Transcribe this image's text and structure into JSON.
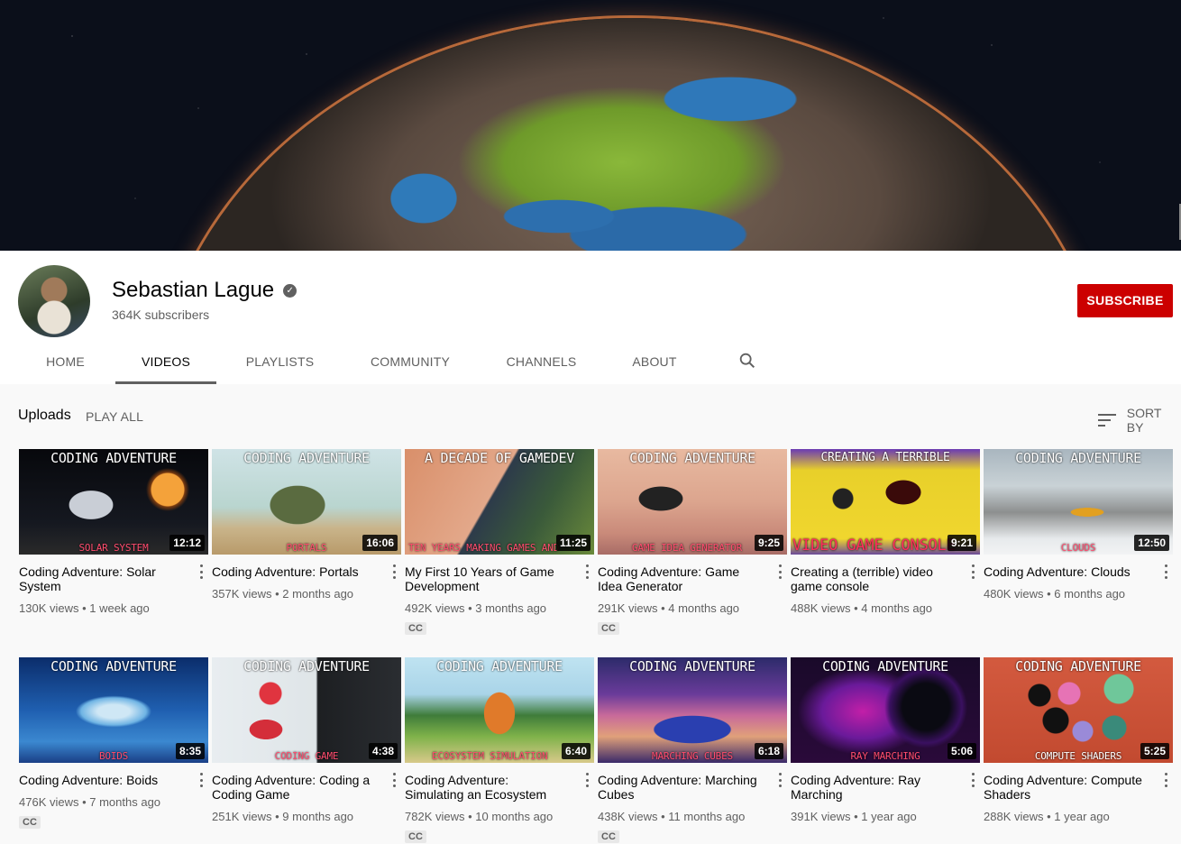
{
  "channel": {
    "name": "Sebastian Lague",
    "subscribers": "364K subscribers",
    "subscribe_label": "SUBSCRIBE",
    "verified_icon": "check-circle-icon"
  },
  "tabs": [
    {
      "label": "HOME"
    },
    {
      "label": "VIDEOS"
    },
    {
      "label": "PLAYLISTS"
    },
    {
      "label": "COMMUNITY"
    },
    {
      "label": "CHANNELS"
    },
    {
      "label": "ABOUT"
    }
  ],
  "section": {
    "title": "Uploads",
    "play_all": "PLAY ALL",
    "sort_by": "SORT BY"
  },
  "colors": {
    "subscribe": "#cc0000",
    "text_secondary": "#606060"
  },
  "videos": [
    {
      "thumb_top": "CODING ADVENTURE",
      "thumb_sub": "SOLAR SYSTEM",
      "duration": "12:12",
      "title": "Coding Adventure: Solar System",
      "views": "130K views",
      "age": "1 week ago",
      "cc": ""
    },
    {
      "thumb_top": "CODING ADVENTURE",
      "thumb_sub": "PORTALS",
      "duration": "16:06",
      "title": "Coding Adventure: Portals",
      "views": "357K views",
      "age": "2 months ago",
      "cc": ""
    },
    {
      "thumb_top": "A DECADE OF GAMEDEV",
      "thumb_sub": "TEN YEARS MAKING GAMES AND",
      "duration": "11:25",
      "title": "My First 10 Years of Game Development",
      "views": "492K views",
      "age": "3 months ago",
      "cc": "CC"
    },
    {
      "thumb_top": "CODING ADVENTURE",
      "thumb_sub": "GAME IDEA GENERATOR",
      "duration": "9:25",
      "title": "Coding Adventure: Game Idea Generator",
      "views": "291K views",
      "age": "4 months ago",
      "cc": "CC"
    },
    {
      "thumb_top": "CREATING A TERRIBLE",
      "thumb_sub": "VIDEO GAME CONSOLE",
      "duration": "9:21",
      "title": "Creating a (terrible) video game console",
      "views": "488K views",
      "age": "4 months ago",
      "cc": ""
    },
    {
      "thumb_top": "CODING ADVENTURE",
      "thumb_sub": "CLOUDS",
      "duration": "12:50",
      "title": "Coding Adventure: Clouds",
      "views": "480K views",
      "age": "6 months ago",
      "cc": ""
    },
    {
      "thumb_top": "CODING ADVENTURE",
      "thumb_sub": "BOIDS",
      "duration": "8:35",
      "title": "Coding Adventure: Boids",
      "views": "476K views",
      "age": "7 months ago",
      "cc": "CC"
    },
    {
      "thumb_top": "CODING ADVENTURE",
      "thumb_sub": "CODING GAME",
      "duration": "4:38",
      "title": "Coding Adventure: Coding a Coding Game",
      "views": "251K views",
      "age": "9 months ago",
      "cc": ""
    },
    {
      "thumb_top": "CODING ADVENTURE",
      "thumb_sub": "ECOSYSTEM SIMULATION",
      "duration": "6:40",
      "title": "Coding Adventure: Simulating an Ecosystem",
      "views": "782K views",
      "age": "10 months ago",
      "cc": "CC"
    },
    {
      "thumb_top": "CODING ADVENTURE",
      "thumb_sub": "MARCHING CUBES",
      "duration": "6:18",
      "title": "Coding Adventure: Marching Cubes",
      "views": "438K views",
      "age": "11 months ago",
      "cc": "CC"
    },
    {
      "thumb_top": "CODING ADVENTURE",
      "thumb_sub": "RAY MARCHING",
      "duration": "5:06",
      "title": "Coding Adventure: Ray Marching",
      "views": "391K views",
      "age": "1 year ago",
      "cc": ""
    },
    {
      "thumb_top": "CODING ADVENTURE",
      "thumb_sub": "COMPUTE SHADERS",
      "duration": "5:25",
      "title": "Coding Adventure: Compute Shaders",
      "views": "288K views",
      "age": "1 year ago",
      "cc": ""
    }
  ]
}
